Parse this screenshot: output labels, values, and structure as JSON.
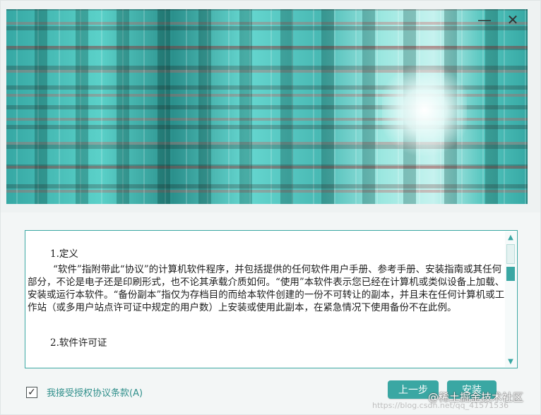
{
  "window": {
    "minimize_icon": "minimize-icon",
    "close_icon": "close-icon",
    "minimize_glyph": "—",
    "close_glyph": "✕"
  },
  "license": {
    "heading1": "1.定义",
    "paragraph1": "“软件”指附带此“协议”的计算机软件程序，并包括提供的任何软件用户手册、参考手册、安装指南或其任何部分，不论是电子还是印刷形式，也不论其承载介质如何。“使用”本软件表示您已经在计算机或类似设备上加载、安装或运行本软件。“备份副本”指仅为存档目的而给本软件创建的一份不可转让的副本，并且未在任何计算机或工作站（或多用户站点许可证中规定的用户数）上安装或使用此副本，在紧急情况下使用备份不在此例。",
    "heading2": "2.软件许可证"
  },
  "scrollbar": {
    "up_glyph": "▲",
    "down_glyph": "▼"
  },
  "accept": {
    "checked": true,
    "check_glyph": "✓",
    "label": "我接受授权协议条款(A)"
  },
  "buttons": {
    "back_label": "上一步",
    "install_label": "安装"
  },
  "watermark": {
    "text": "@稀土掘金技术社区",
    "url": "https://blog.csdn.net/qq_41571536"
  },
  "colors": {
    "accent": "#3aa7a3",
    "label_text": "#2f8f8b"
  }
}
